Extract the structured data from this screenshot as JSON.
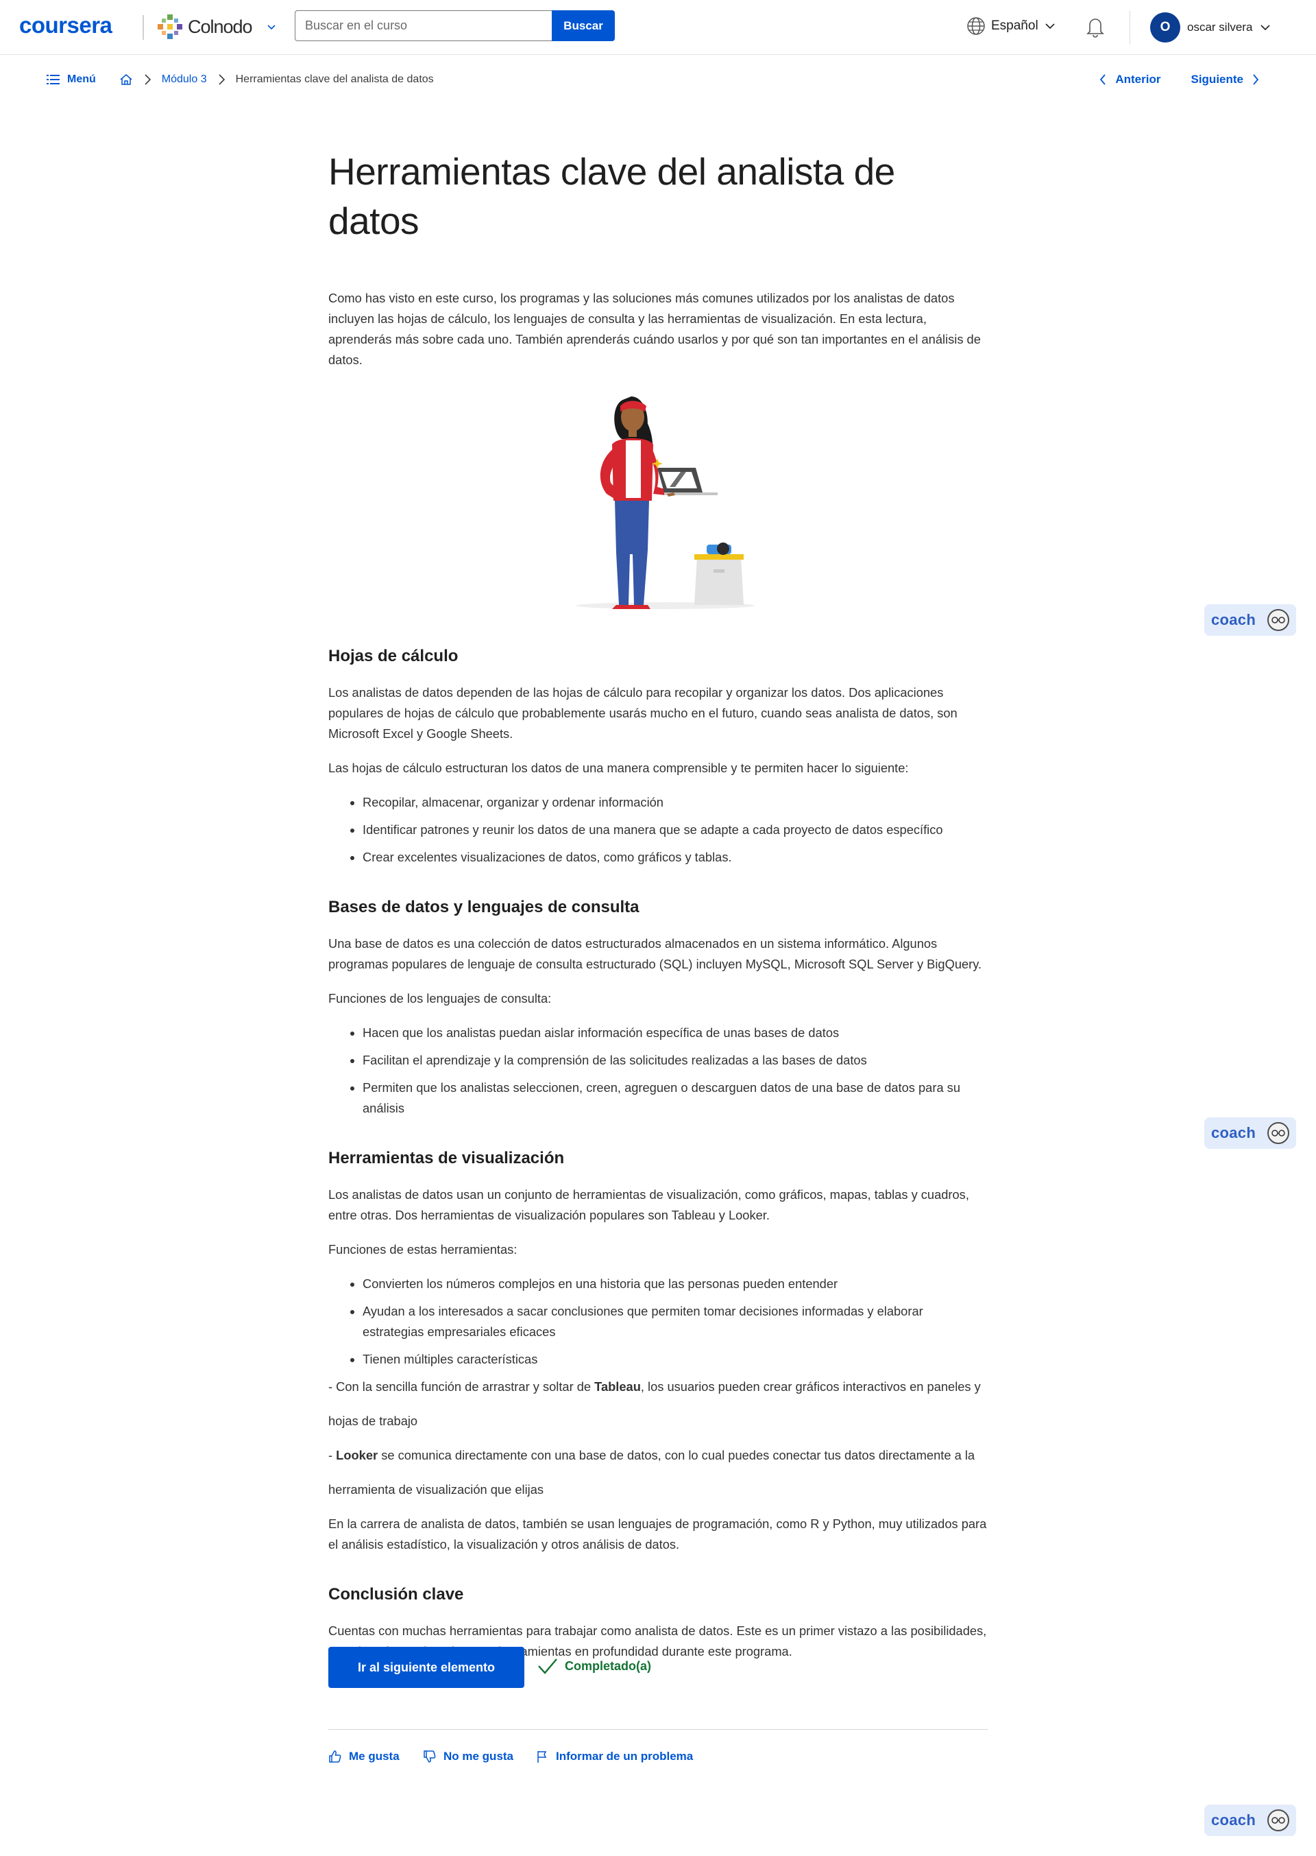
{
  "header": {
    "logo": "coursera",
    "partner": "Colnodo",
    "search_placeholder": "Buscar en el curso",
    "search_button": "Buscar",
    "language": "Español",
    "user_initial": "O",
    "user_name": "oscar silvera",
    "brand_color": "#0056d2"
  },
  "breadcrumb": {
    "menu": "Menú",
    "module": "Módulo 3",
    "current": "Herramientas clave del analista de datos",
    "previous": "Anterior",
    "next": "Siguiente"
  },
  "article": {
    "title": "Herramientas clave del analista de datos",
    "intro": "Como has visto en este curso, los programas y las soluciones más comunes utilizados por los analistas de datos incluyen las hojas de cálculo, los lenguajes de consulta y las herramientas de visualización. En esta lectura, aprenderás más sobre cada uno. También aprenderás cuándo usarlos y por qué son tan importantes en el análisis de datos.",
    "s1": {
      "heading": "Hojas de cálculo",
      "p1": "Los analistas de datos dependen de las hojas de cálculo para recopilar y organizar los datos. Dos aplicaciones populares de hojas de cálculo que probablemente usarás mucho en el futuro, cuando seas analista de datos, son Microsoft Excel y Google Sheets.",
      "p2": "Las hojas de cálculo estructuran los datos de una manera comprensible y te permiten hacer lo siguiente:",
      "items": [
        "Recopilar, almacenar, organizar y ordenar información",
        "Identificar patrones y reunir los datos de una manera que se adapte a cada proyecto de datos específico",
        "Crear excelentes visualizaciones de datos, como gráficos y tablas."
      ]
    },
    "s2": {
      "heading": "Bases de datos y lenguajes de consulta",
      "p1": "Una base de datos es una colección de datos estructurados almacenados en un sistema informático. Algunos programas populares de lenguaje de consulta estructurado (SQL) incluyen MySQL, Microsoft SQL Server y BigQuery.",
      "p2": "Funciones de los lenguajes de consulta:",
      "items": [
        "Hacen que los analistas puedan aislar información específica de unas bases de datos",
        "Facilitan el aprendizaje y la comprensión de las solicitudes realizadas a las bases de datos",
        "Permiten que los analistas seleccionen, creen, agreguen o descarguen datos de una base de datos para su análisis"
      ]
    },
    "s3": {
      "heading": "Herramientas de visualización",
      "p1": "Los analistas de datos usan un conjunto de herramientas de visualización, como gráficos, mapas, tablas y cuadros, entre otras. Dos herramientas de visualización populares son Tableau y Looker.",
      "p2": "Funciones de estas herramientas:",
      "items": [
        "Convierten los números complejos en una historia que las personas pueden entender",
        "Ayudan a los interesados a sacar conclusiones que permiten tomar decisiones informadas y elaborar estrategias empresariales eficaces",
        "Tienen múltiples características"
      ],
      "tableau_pre": "- Con la sencilla función de arrastrar y soltar de ",
      "tableau_bold": "Tableau",
      "tableau_post": ", los usuarios pueden crear gráficos interactivos en paneles y",
      "tableau_cont": "hojas de trabajo",
      "looker_pre": "- ",
      "looker_bold": "Looker",
      "looker_post": " se comunica directamente con una base de datos, con lo cual puedes conectar tus datos directamente a la",
      "looker_cont": "herramienta de visualización que elijas",
      "p3": "En la carrera de analista de datos, también se usan lenguajes de programación, como R y Python, muy utilizados para el análisis estadístico, la visualización y otros análisis de datos."
    },
    "s4": {
      "heading": "Conclusión clave",
      "p1": "Cuentas con muchas herramientas para trabajar como analista de datos. Este es un primer vistazo a las posibilidades, y explorarás muchas de estas herramientas en profundidad durante este programa."
    }
  },
  "actions": {
    "next_item": "Ir al siguiente elemento",
    "completed": "Completado(a)",
    "like": "Me gusta",
    "dislike": "No me gusta",
    "report": "Informar de un problema"
  },
  "coach": {
    "label": "coach"
  }
}
